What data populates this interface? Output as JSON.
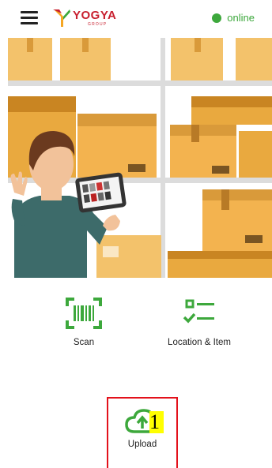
{
  "header": {
    "menu_icon": "hamburger-menu-icon",
    "logo_text": "YOGYA",
    "logo_subtext": "GROUP",
    "status_text": "online",
    "status_color": "#3da83c"
  },
  "colors": {
    "accent": "#3da83c",
    "brand_red": "#c8202f",
    "highlight_border": "#e3111b",
    "badge_yellow": "#ffff00"
  },
  "menu": {
    "scan_label": "Scan",
    "scan_icon": "barcode-scan-icon",
    "location_item_label": "Location & Item",
    "location_item_icon": "checklist-icon",
    "upload_label": "Upload",
    "upload_icon": "cloud-upload-icon",
    "upload_badge": "1"
  }
}
